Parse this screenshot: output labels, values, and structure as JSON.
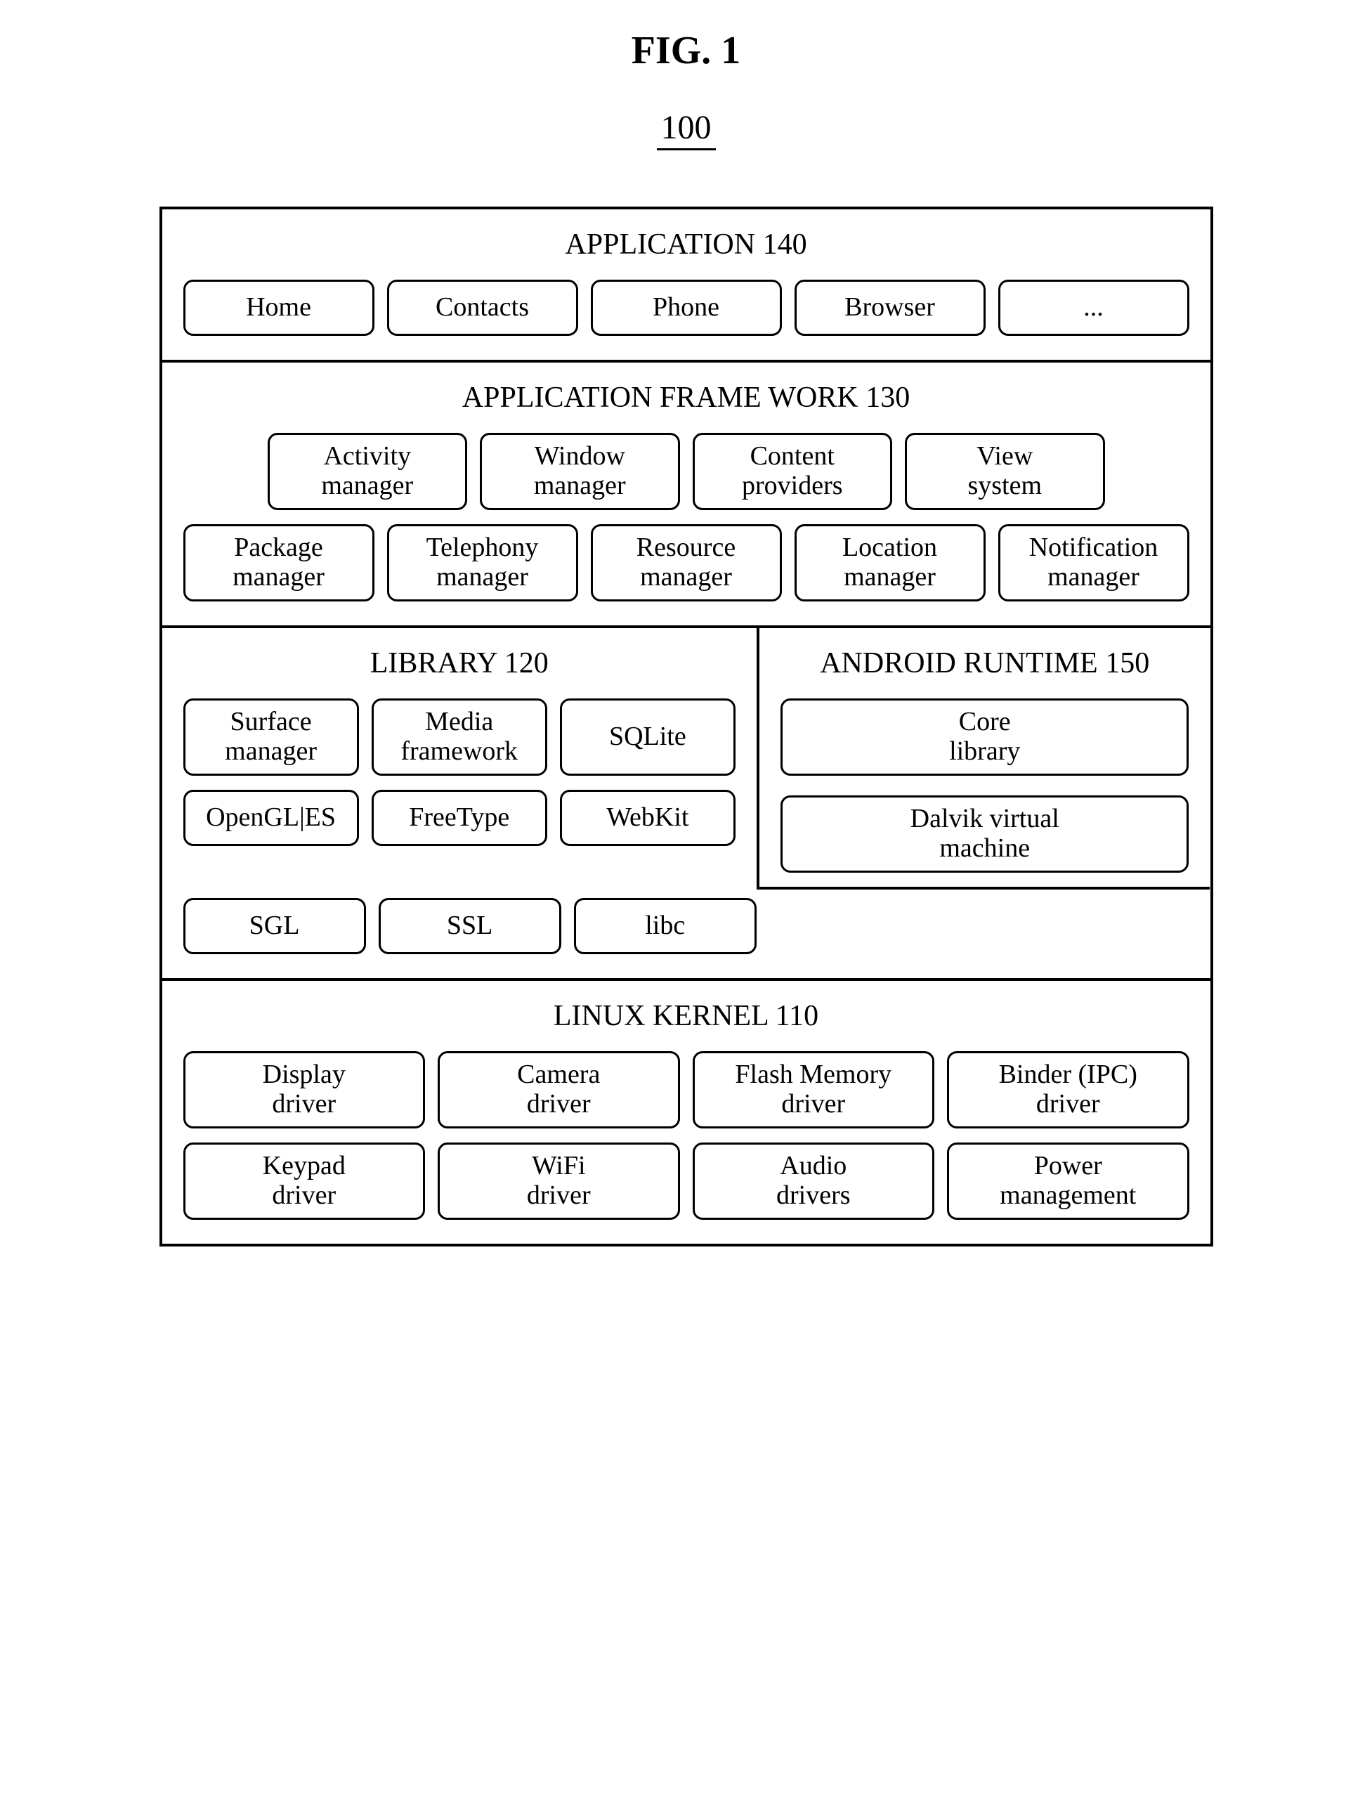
{
  "figure": {
    "title": "FIG. 1",
    "number": "100"
  },
  "application": {
    "title": "APPLICATION 140",
    "items": [
      "Home",
      "Contacts",
      "Phone",
      "Browser",
      "..."
    ]
  },
  "framework": {
    "title": "APPLICATION FRAME WORK 130",
    "row1": [
      "Activity\nmanager",
      "Window\nmanager",
      "Content\nproviders",
      "View\nsystem"
    ],
    "row2": [
      "Package\nmanager",
      "Telephony\nmanager",
      "Resource\nmanager",
      "Location\nmanager",
      "Notification\nmanager"
    ]
  },
  "library": {
    "title": "LIBRARY 120",
    "row1": [
      "Surface\nmanager",
      "Media\nframework",
      "SQLite"
    ],
    "row2": [
      "OpenGL|ES",
      "FreeType",
      "WebKit"
    ],
    "row3": [
      "SGL",
      "SSL",
      "libc"
    ]
  },
  "runtime": {
    "title": "ANDROID RUNTIME 150",
    "items": [
      "Core\nlibrary",
      "Dalvik virtual\nmachine"
    ]
  },
  "kernel": {
    "title": "LINUX KERNEL 110",
    "row1": [
      "Display\ndriver",
      "Camera\ndriver",
      "Flash Memory\ndriver",
      "Binder (IPC)\ndriver"
    ],
    "row2": [
      "Keypad\ndriver",
      "WiFi\ndriver",
      "Audio\ndrivers",
      "Power\nmanagement"
    ]
  }
}
